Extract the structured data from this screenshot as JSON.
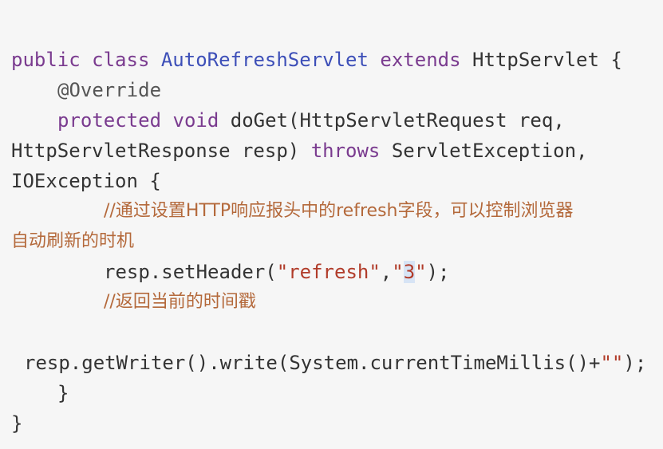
{
  "colors": {
    "background": "#f6f6f6",
    "keyword": "#7a3b8f",
    "class_name": "#3d4fb8",
    "string": "#b13c2a",
    "comment": "#b4693b",
    "plain": "#333333"
  },
  "code": {
    "line1": {
      "kw_public": "public",
      "kw_class": "class",
      "class_name": "AutoRefreshServlet",
      "kw_extends": "extends",
      "parent": "HttpServlet",
      "brace": "{"
    },
    "line2": {
      "annotation": "@Override"
    },
    "line3": {
      "kw_protected": "protected",
      "kw_void": "void",
      "method": "doGet(HttpServletRequest req,"
    },
    "line4": {
      "params": "HttpServletResponse resp)",
      "kw_throws": "throws",
      "exception": "ServletException,"
    },
    "line5": {
      "text": "IOException {"
    },
    "line6": {
      "comment": "//通过设置HTTP响应报头中的refresh字段，可以控制浏览器"
    },
    "line7": {
      "comment": "自动刷新的时机"
    },
    "line8": {
      "call": "resp.setHeader(",
      "arg1": "\"refresh\"",
      "comma": ",",
      "arg2_open": "\"",
      "arg2_value": "3",
      "arg2_close": "\"",
      "end": ");"
    },
    "line9": {
      "comment": "//返回当前的时间戳"
    },
    "line10": {
      "call": "resp.getWriter().write(System.currentTimeMillis()+",
      "str": "\"\"",
      "end": ");"
    },
    "line11": {
      "text": "}"
    },
    "line12": {
      "text": "}"
    }
  }
}
